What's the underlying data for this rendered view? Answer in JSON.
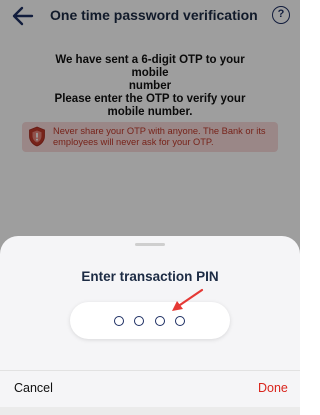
{
  "header": {
    "title": "One time password verification",
    "back_icon": "arrow-left-icon",
    "help_icon": "question-circle-icon",
    "help_label": "?"
  },
  "otp_message": {
    "line1": "We have sent a 6-digit OTP to your mobile",
    "line2": "number",
    "line3": "Please enter the OTP to verify your",
    "line4": "mobile number."
  },
  "warning": {
    "icon": "shield-warning-icon",
    "line1": "Never share your OTP with anyone. The Bank or its",
    "line2": "employees will never ask for your OTP."
  },
  "sheet": {
    "title": "Enter transaction PIN",
    "pin_length": 4,
    "cancel_label": "Cancel",
    "done_label": "Done"
  },
  "colors": {
    "accent_red": "#d9251c",
    "navy": "#1e2f63",
    "warning_bg": "#f8dada"
  }
}
